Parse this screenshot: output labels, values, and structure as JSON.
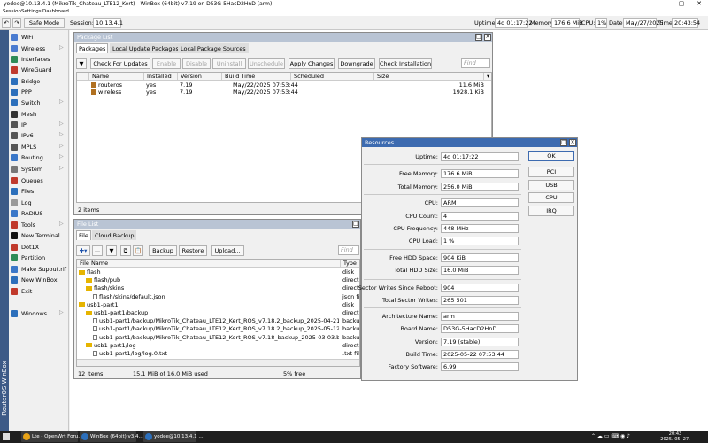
{
  "window": {
    "title": "yodee@10.13.4.1 (MikroTik_Chateau_LTE12_Kert) - WinBox (64bit) v7.19 on D53G-5HacD2HnD (arm)",
    "minimize": "—",
    "maximize": "▢",
    "close": "✕"
  },
  "menu": [
    "Session",
    "Settings",
    "Dashboard"
  ],
  "toolbar": {
    "undo": "↶",
    "redo": "↷",
    "safe_mode": "Safe Mode",
    "session_label": "Session:",
    "session_value": "10.13.4.1",
    "status": [
      {
        "label": "Uptime:",
        "value": "4d 01:17:22"
      },
      {
        "label": "Memory:",
        "value": "176.6 MiB"
      },
      {
        "label": "CPU:",
        "value": "1%"
      },
      {
        "label": "Date:",
        "value": "May/27/2025"
      },
      {
        "label": "Time:",
        "value": "20:43:54"
      }
    ]
  },
  "sidebar": {
    "vertical_label": "RouterOS WinBox",
    "items": [
      {
        "label": "WiFi",
        "icon": "wifi-icon",
        "color": "#4a7bd0",
        "arrow": false
      },
      {
        "label": "Wireless",
        "icon": "wireless-icon",
        "color": "#4a7bd0",
        "arrow": true
      },
      {
        "label": "Interfaces",
        "icon": "interfaces-icon",
        "color": "#2e8b57",
        "arrow": false
      },
      {
        "label": "WireGuard",
        "icon": "wireguard-icon",
        "color": "#c0392b",
        "arrow": false
      },
      {
        "label": "Bridge",
        "icon": "bridge-icon",
        "color": "#2c6fbb",
        "arrow": false
      },
      {
        "label": "PPP",
        "icon": "ppp-icon",
        "color": "#2c6fbb",
        "arrow": false
      },
      {
        "label": "Switch",
        "icon": "switch-icon",
        "color": "#2c6fbb",
        "arrow": true
      },
      {
        "label": "Mesh",
        "icon": "mesh-icon",
        "color": "#333333",
        "arrow": false
      },
      {
        "label": "IP",
        "icon": "ip-icon",
        "color": "#555555",
        "arrow": true
      },
      {
        "label": "IPv6",
        "icon": "ipv6-icon",
        "color": "#555555",
        "arrow": true
      },
      {
        "label": "MPLS",
        "icon": "mpls-icon",
        "color": "#555555",
        "arrow": true
      },
      {
        "label": "Routing",
        "icon": "routing-icon",
        "color": "#3a77c8",
        "arrow": true
      },
      {
        "label": "System",
        "icon": "system-icon",
        "color": "#777777",
        "arrow": true
      },
      {
        "label": "Queues",
        "icon": "queues-icon",
        "color": "#c0392b",
        "arrow": false
      },
      {
        "label": "Files",
        "icon": "files-icon",
        "color": "#2c6fbb",
        "arrow": false
      },
      {
        "label": "Log",
        "icon": "log-icon",
        "color": "#999999",
        "arrow": false
      },
      {
        "label": "RADIUS",
        "icon": "radius-icon",
        "color": "#3a77c8",
        "arrow": false
      },
      {
        "label": "Tools",
        "icon": "tools-icon",
        "color": "#c0392b",
        "arrow": true
      },
      {
        "label": "New Terminal",
        "icon": "terminal-icon",
        "color": "#111111",
        "arrow": false
      },
      {
        "label": "Dot1X",
        "icon": "dot1x-icon",
        "color": "#c0392b",
        "arrow": false
      },
      {
        "label": "Partition",
        "icon": "partition-icon",
        "color": "#2e8b57",
        "arrow": false
      },
      {
        "label": "Make Supout.rif",
        "icon": "supout-icon",
        "color": "#3a77c8",
        "arrow": false
      },
      {
        "label": "New WinBox",
        "icon": "winbox-icon",
        "color": "#2c6fbb",
        "arrow": false
      },
      {
        "label": "Exit",
        "icon": "exit-icon",
        "color": "#c0392b",
        "arrow": false
      },
      {
        "label": "Windows",
        "icon": "windows-icon",
        "color": "#2c6fbb",
        "arrow": true
      }
    ]
  },
  "package_list": {
    "title": "Package List",
    "tabs": [
      "Packages",
      "Local Update Packages",
      "Local Package Sources"
    ],
    "buttons": [
      {
        "label": "Check For Updates",
        "disabled": false
      },
      {
        "label": "Enable",
        "disabled": true
      },
      {
        "label": "Disable",
        "disabled": true
      },
      {
        "label": "Uninstall",
        "disabled": true
      },
      {
        "label": "Unschedule",
        "disabled": true
      },
      {
        "label": "Apply Changes",
        "disabled": false
      },
      {
        "label": "Downgrade",
        "disabled": false
      },
      {
        "label": "Check Installation",
        "disabled": false
      }
    ],
    "find_placeholder": "Find",
    "columns": [
      "Name",
      "Installed",
      "Version",
      "Build Time",
      "Scheduled",
      "Size"
    ],
    "rows": [
      {
        "name": "routeros",
        "installed": "yes",
        "version": "7.19",
        "build_time": "May/22/2025 07:53:44",
        "scheduled": "",
        "size": "11.6 MiB"
      },
      {
        "name": "wireless",
        "installed": "yes",
        "version": "7.19",
        "build_time": "May/22/2025 07:53:44",
        "scheduled": "",
        "size": "1928.1 KiB"
      }
    ],
    "status": "2 items"
  },
  "file_list": {
    "title": "File List",
    "tabs": [
      "File",
      "Cloud Backup"
    ],
    "buttons": [
      "Backup",
      "Restore",
      "Upload..."
    ],
    "find_placeholder": "Find",
    "columns": [
      "File Name",
      "Type"
    ],
    "rows": [
      {
        "name": "flash",
        "type": "disk",
        "indent": 0,
        "icon": "folder"
      },
      {
        "name": "flash/pub",
        "type": "directory",
        "indent": 1,
        "icon": "folder"
      },
      {
        "name": "flash/skins",
        "type": "directory",
        "indent": 1,
        "icon": "folder"
      },
      {
        "name": "flash/skins/default.json",
        "type": "json file",
        "indent": 2,
        "icon": "doc"
      },
      {
        "name": "usb1-part1",
        "type": "disk",
        "indent": 0,
        "icon": "folder"
      },
      {
        "name": "usb1-part1/backup",
        "type": "directory",
        "indent": 1,
        "icon": "folder"
      },
      {
        "name": "usb1-part1/backup/MikroTik_Chateau_LTE12_Kert_ROS_v7.18.2_backup_2025-04-21.backup",
        "type": "backup",
        "indent": 2,
        "icon": "doc"
      },
      {
        "name": "usb1-part1/backup/MikroTik_Chateau_LTE12_Kert_ROS_v7.18.2_backup_2025-05-12.backup",
        "type": "backup",
        "indent": 2,
        "icon": "doc"
      },
      {
        "name": "usb1-part1/backup/MikroTik_Chateau_LTE12_Kert_ROS_v7.18_backup_2025-03-03.backup",
        "type": "backup",
        "indent": 2,
        "icon": "doc"
      },
      {
        "name": "usb1-part1/log",
        "type": "directory",
        "indent": 1,
        "icon": "folder"
      },
      {
        "name": "usb1-part1/log/log.0.txt",
        "type": ".txt file",
        "indent": 2,
        "icon": "doc"
      }
    ],
    "status": {
      "items": "12 items",
      "used": "15.1 MiB of 16.0 MiB used",
      "free": "5% free"
    }
  },
  "resources": {
    "title": "Resources",
    "fields": [
      {
        "label": "Uptime:",
        "value": "4d 01:17:22"
      },
      {
        "label": "Free Memory:",
        "value": "176.6 MiB"
      },
      {
        "label": "Total Memory:",
        "value": "256.0 MiB"
      },
      {
        "label": "CPU:",
        "value": "ARM"
      },
      {
        "label": "CPU Count:",
        "value": "4"
      },
      {
        "label": "CPU Frequency:",
        "value": "448 MHz"
      },
      {
        "label": "CPU Load:",
        "value": "1 %"
      },
      {
        "label": "Free HDD Space:",
        "value": "904 KiB"
      },
      {
        "label": "Total HDD Size:",
        "value": "16.0 MiB"
      },
      {
        "label": "Sector Writes Since Reboot:",
        "value": "904"
      },
      {
        "label": "Total Sector Writes:",
        "value": "265 501"
      },
      {
        "label": "Architecture Name:",
        "value": "arm"
      },
      {
        "label": "Board Name:",
        "value": "D53G-5HacD2HnD"
      },
      {
        "label": "Version:",
        "value": "7.19 (stable)"
      },
      {
        "label": "Build Time:",
        "value": "2025-05-22 07:53:44"
      },
      {
        "label": "Factory Software:",
        "value": "6.99"
      }
    ],
    "buttons": [
      "OK",
      "PCI",
      "USB",
      "CPU",
      "IRQ"
    ]
  },
  "taskbar": {
    "items": [
      {
        "label": "Lte - OpenWrt Foru...",
        "color": "#e8a317"
      },
      {
        "label": "WinBox (64bit) v3.4...",
        "color": "#2c6fbb"
      },
      {
        "label": "yodee@10.13.4.1 ...",
        "color": "#2c6fbb"
      }
    ],
    "time": "20:43",
    "date": "2025. 05. 27."
  }
}
